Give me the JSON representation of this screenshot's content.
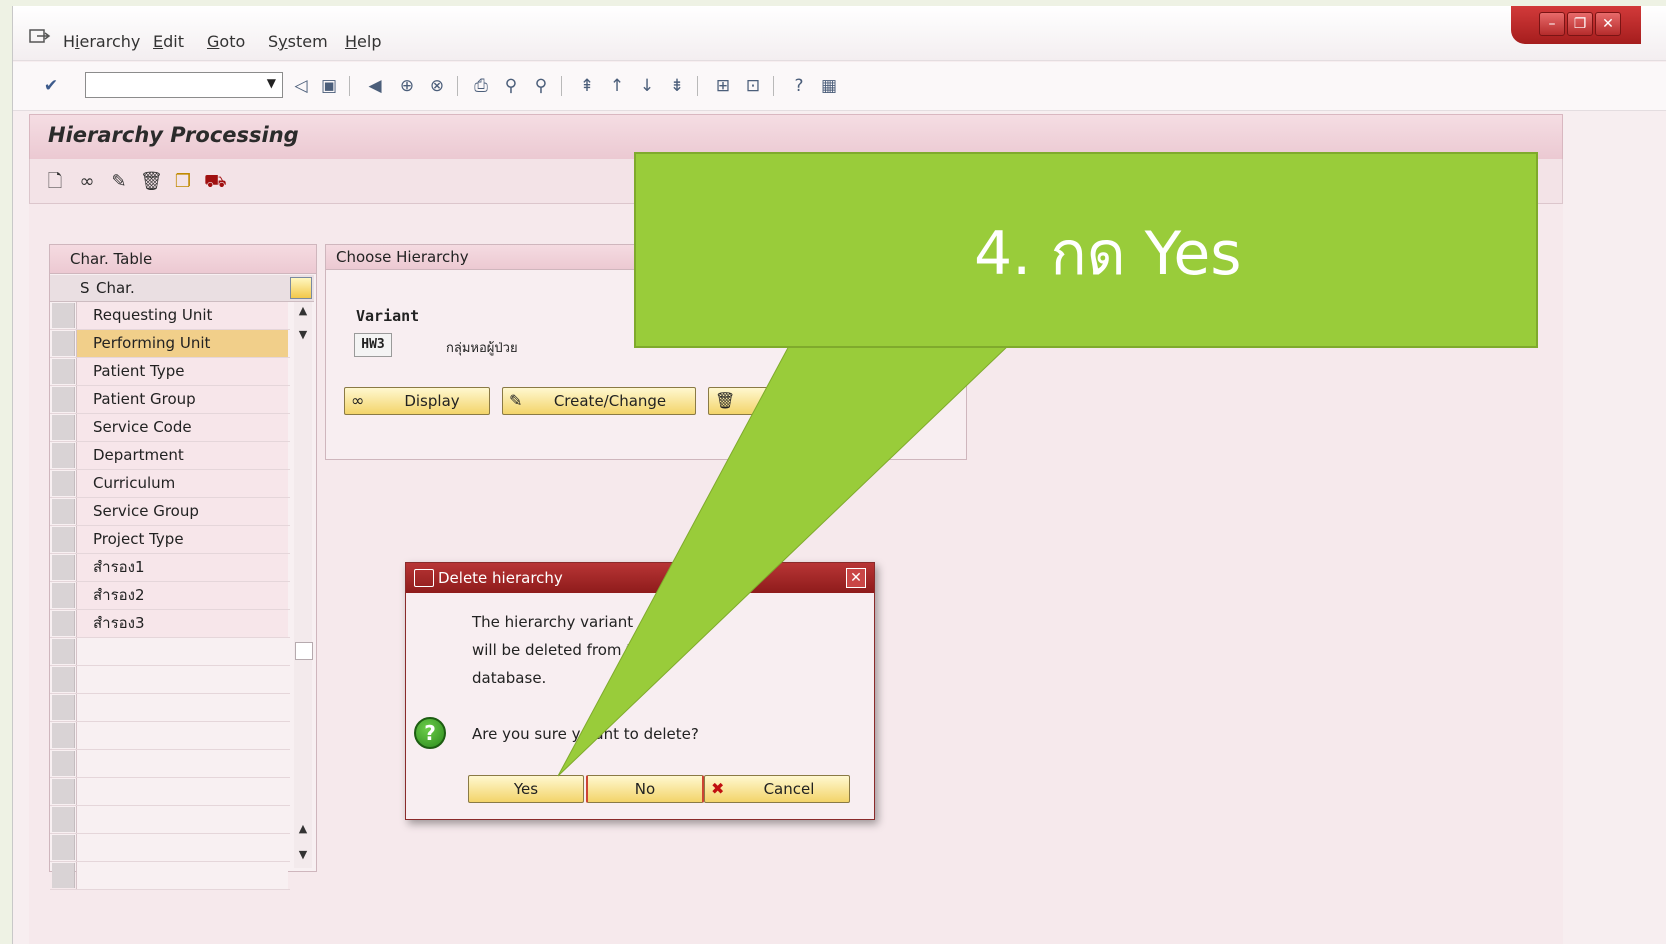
{
  "menubar": {
    "items": [
      {
        "label": "Hierarchy",
        "underline_index": 1
      },
      {
        "label": "Edit",
        "underline_index": 0
      },
      {
        "label": "Goto",
        "underline_index": 0
      },
      {
        "label": "System",
        "underline_index": 1
      },
      {
        "label": "Help",
        "underline_index": 0
      }
    ]
  },
  "title": "Hierarchy Processing",
  "char_table": {
    "header": "Char. Table",
    "col_s": "S",
    "col_char": "Char.",
    "rows": [
      "Requesting Unit",
      "Performing Unit",
      "Patient Type",
      "Patient Group",
      "Service Code",
      "Department",
      "Curriculum",
      "Service Group",
      "Project Type",
      "สำรอง1",
      "สำรอง2",
      "สำรอง3"
    ],
    "selected_row": "Performing Unit"
  },
  "choose": {
    "header": "Choose Hierarchy",
    "variant_label": "Variant",
    "variant_value": "HW3",
    "variant_desc": "กลุ่มหอผู้ป่วย",
    "display_label": "Display",
    "create_label": "Create/Change"
  },
  "dialog": {
    "title": "Delete hierarchy",
    "line1": "The hierarchy variant",
    "line2": "will be deleted from th",
    "line3": "database.",
    "question": "Are you sure yo   ant to delete?",
    "yes": "Yes",
    "no": "No",
    "cancel": "Cancel"
  },
  "callout": {
    "text": "4. กด Yes",
    "color": "#99cc3a"
  },
  "colors": {
    "accent_red": "#a51d1d",
    "button_yellow": "#f3d46a",
    "selected_row": "#f1cf8a"
  }
}
